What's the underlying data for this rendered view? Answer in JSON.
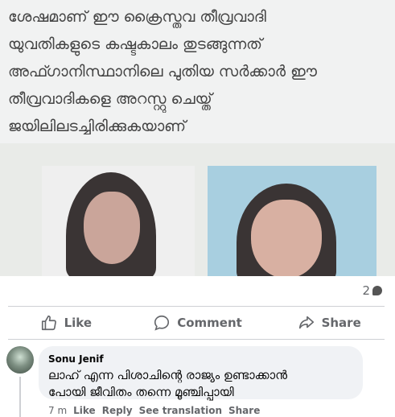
{
  "post": {
    "text_lines": [
      "ശേഷമാണ് ഈ ക്രൈസ്തവ തീവ്രവാദി",
      "യുവതികളുടെ കഷ്ടകാലം തുടങ്ങുന്നത്",
      "അഫ്ഗാനിസ്ഥാനിലെ പുതിയ സർക്കാർ ഈ",
      "തീവ്രവാദികളെ അറസ്റ്റു ചെയ്ത്",
      "ജയിലിലടച്ചിരിക്കുകയാണ്"
    ]
  },
  "stats": {
    "comment_count": "2"
  },
  "actions": {
    "like": "Like",
    "comment": "Comment",
    "share": "Share"
  },
  "comment": {
    "author": "Sonu Jenif",
    "text_line1": "ലാഹ് എന്ന പിശാചിന്റെ രാജ്യം ഉണ്ടാക്കാൻ",
    "text_line2": "പോയി ജീവിതം തന്നെ മൂഞ്ചിപ്പായി",
    "time": "7 m",
    "like": "Like",
    "reply": "Reply",
    "see_translation": "See translation",
    "share": "Share"
  },
  "colors": {
    "muted": "#65676b",
    "bubble": "#f0f2f5",
    "post_bg": "#f1f2f2"
  }
}
